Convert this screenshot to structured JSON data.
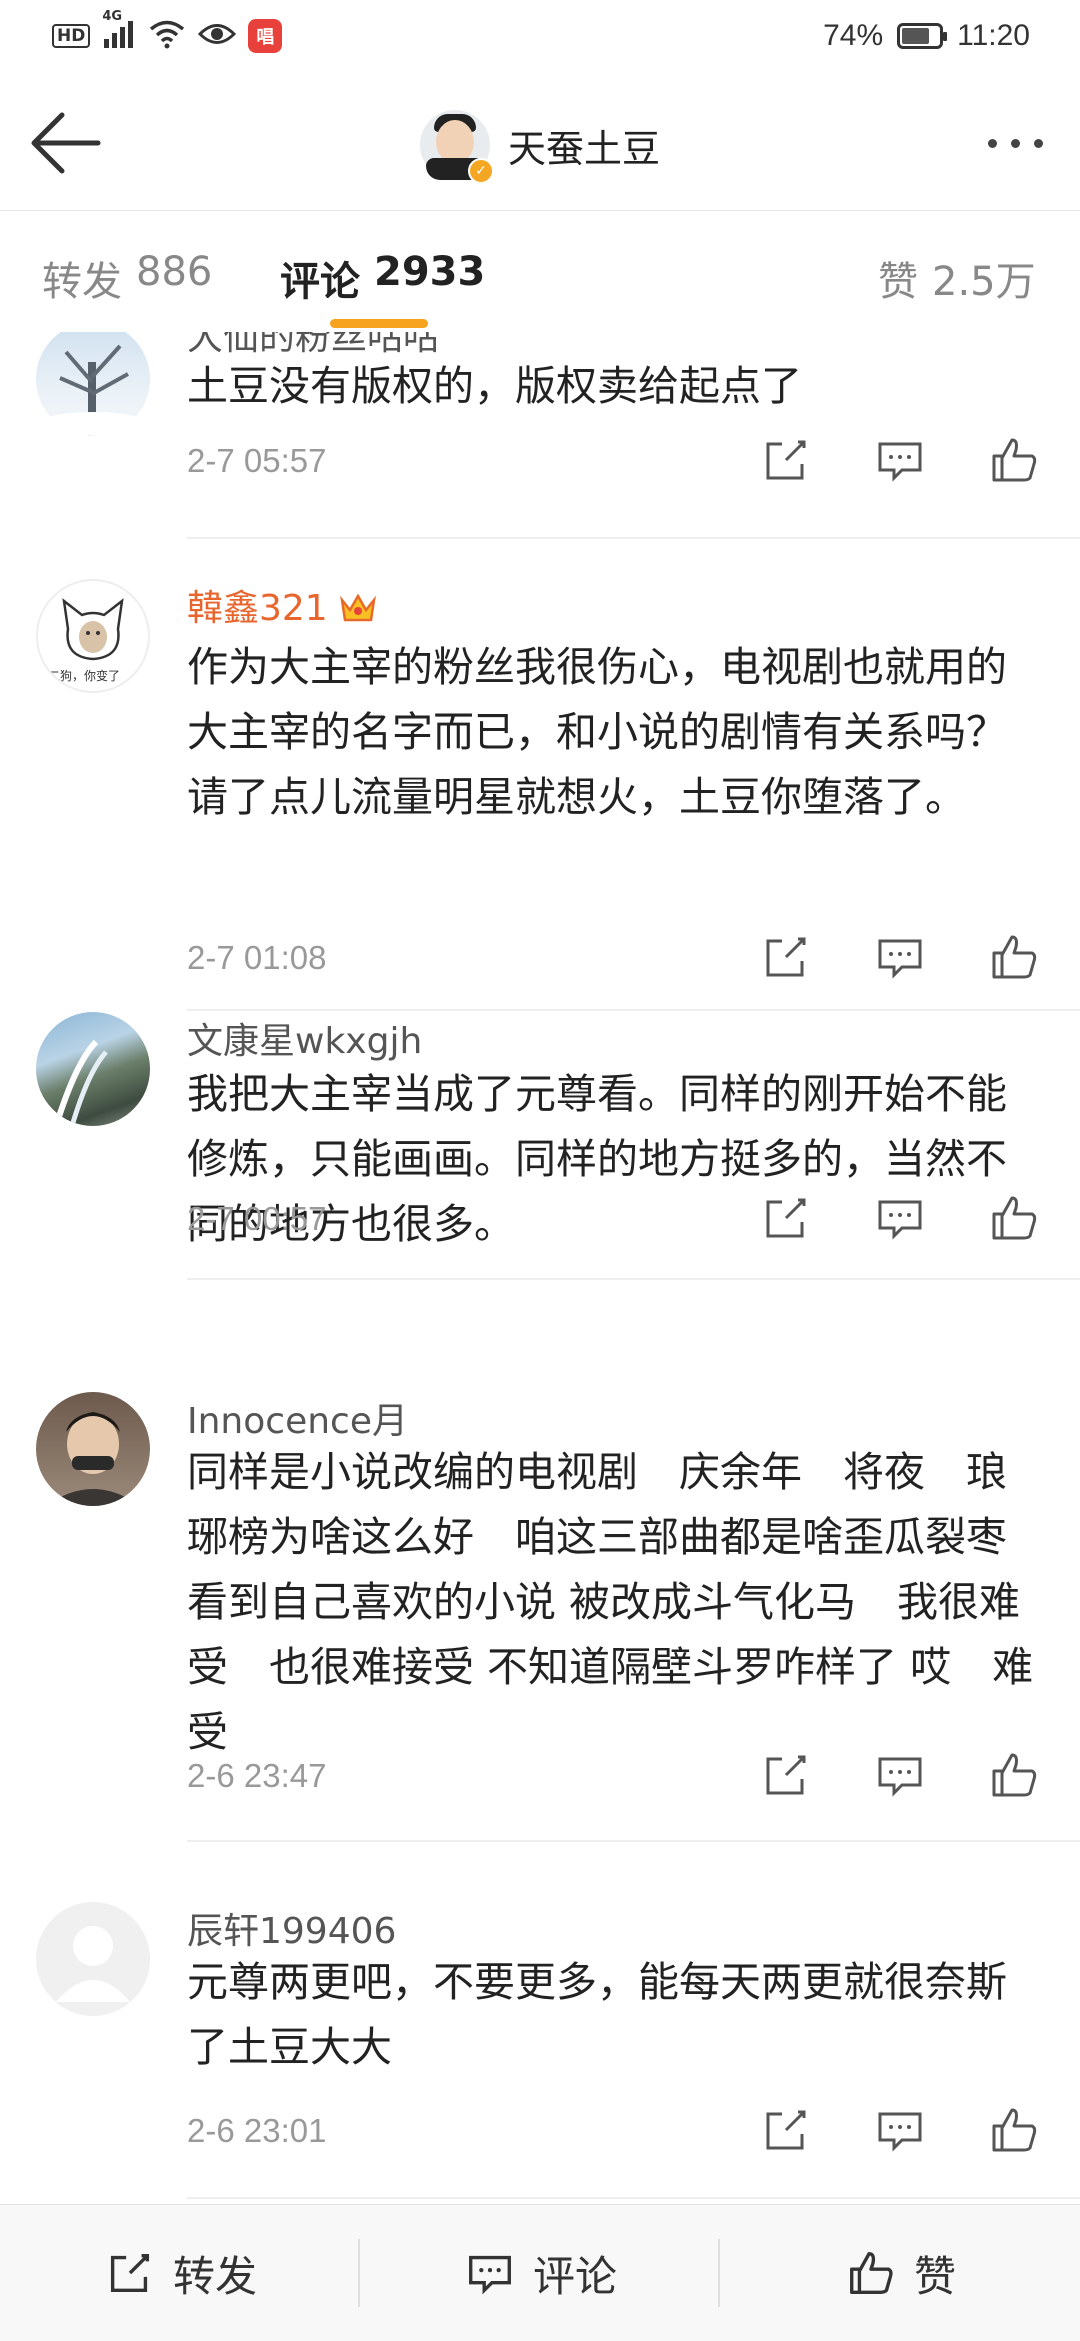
{
  "status_bar": {
    "hd": "HD",
    "network": "4G",
    "app_badge": "唱",
    "battery": "74%",
    "battery_level": 0.74,
    "time": "11:20"
  },
  "nav": {
    "title": "天蚕土豆"
  },
  "tabs": [
    {
      "label": "转发",
      "count": "886"
    },
    {
      "label": "评论",
      "count": "2933",
      "active": true
    },
    {
      "label": "赞",
      "count": "2.5万"
    }
  ],
  "comments": [
    {
      "name": "大仙的粉丝咕咕",
      "text": "土豆没有版权的，版权卖给起点了",
      "time": "2-7 05:57",
      "avatar": "tree"
    },
    {
      "name": "韓鑫321",
      "vip": true,
      "text": "作为大主宰的粉丝我很伤心，电视剧也就用的大主宰的名字而已，和小说的剧情有关系吗？请了点儿流量明星就想火，土豆你堕落了。",
      "time": "2-7 01:08",
      "avatar": "cat",
      "avatar_caption": "二狗，你变了"
    },
    {
      "name": "文康星wkxgjh",
      "text": "我把大主宰当成了元尊看。同样的刚开始不能修炼，只能画画。同样的地方挺多的，当然不同的地方也很多。",
      "time": "2-7 00:57",
      "avatar": "landscape"
    },
    {
      "name": "Innocence月",
      "text": "同样是小说改编的电视剧　庆余年　将夜　琅琊榜为啥这么好　咱这三部曲都是啥歪瓜裂枣　看到自己喜欢的小说 被改成斗气化马　我很难受　也很难接受 不知道隔壁斗罗咋样了 哎　难受",
      "time": "2-6 23:47",
      "avatar": "person"
    },
    {
      "name": "辰轩199406",
      "text": "元尊两更吧，不要更多，能每天两更就很奈斯了土豆大大",
      "time": "2-6 23:01",
      "avatar": "default"
    }
  ],
  "bottom_bar": {
    "repost": "转发",
    "comment": "评论",
    "like": "赞"
  },
  "colors": {
    "accent": "#f7a31f",
    "vip_name": "#e8662d",
    "verify_badge": "#f5a623"
  }
}
